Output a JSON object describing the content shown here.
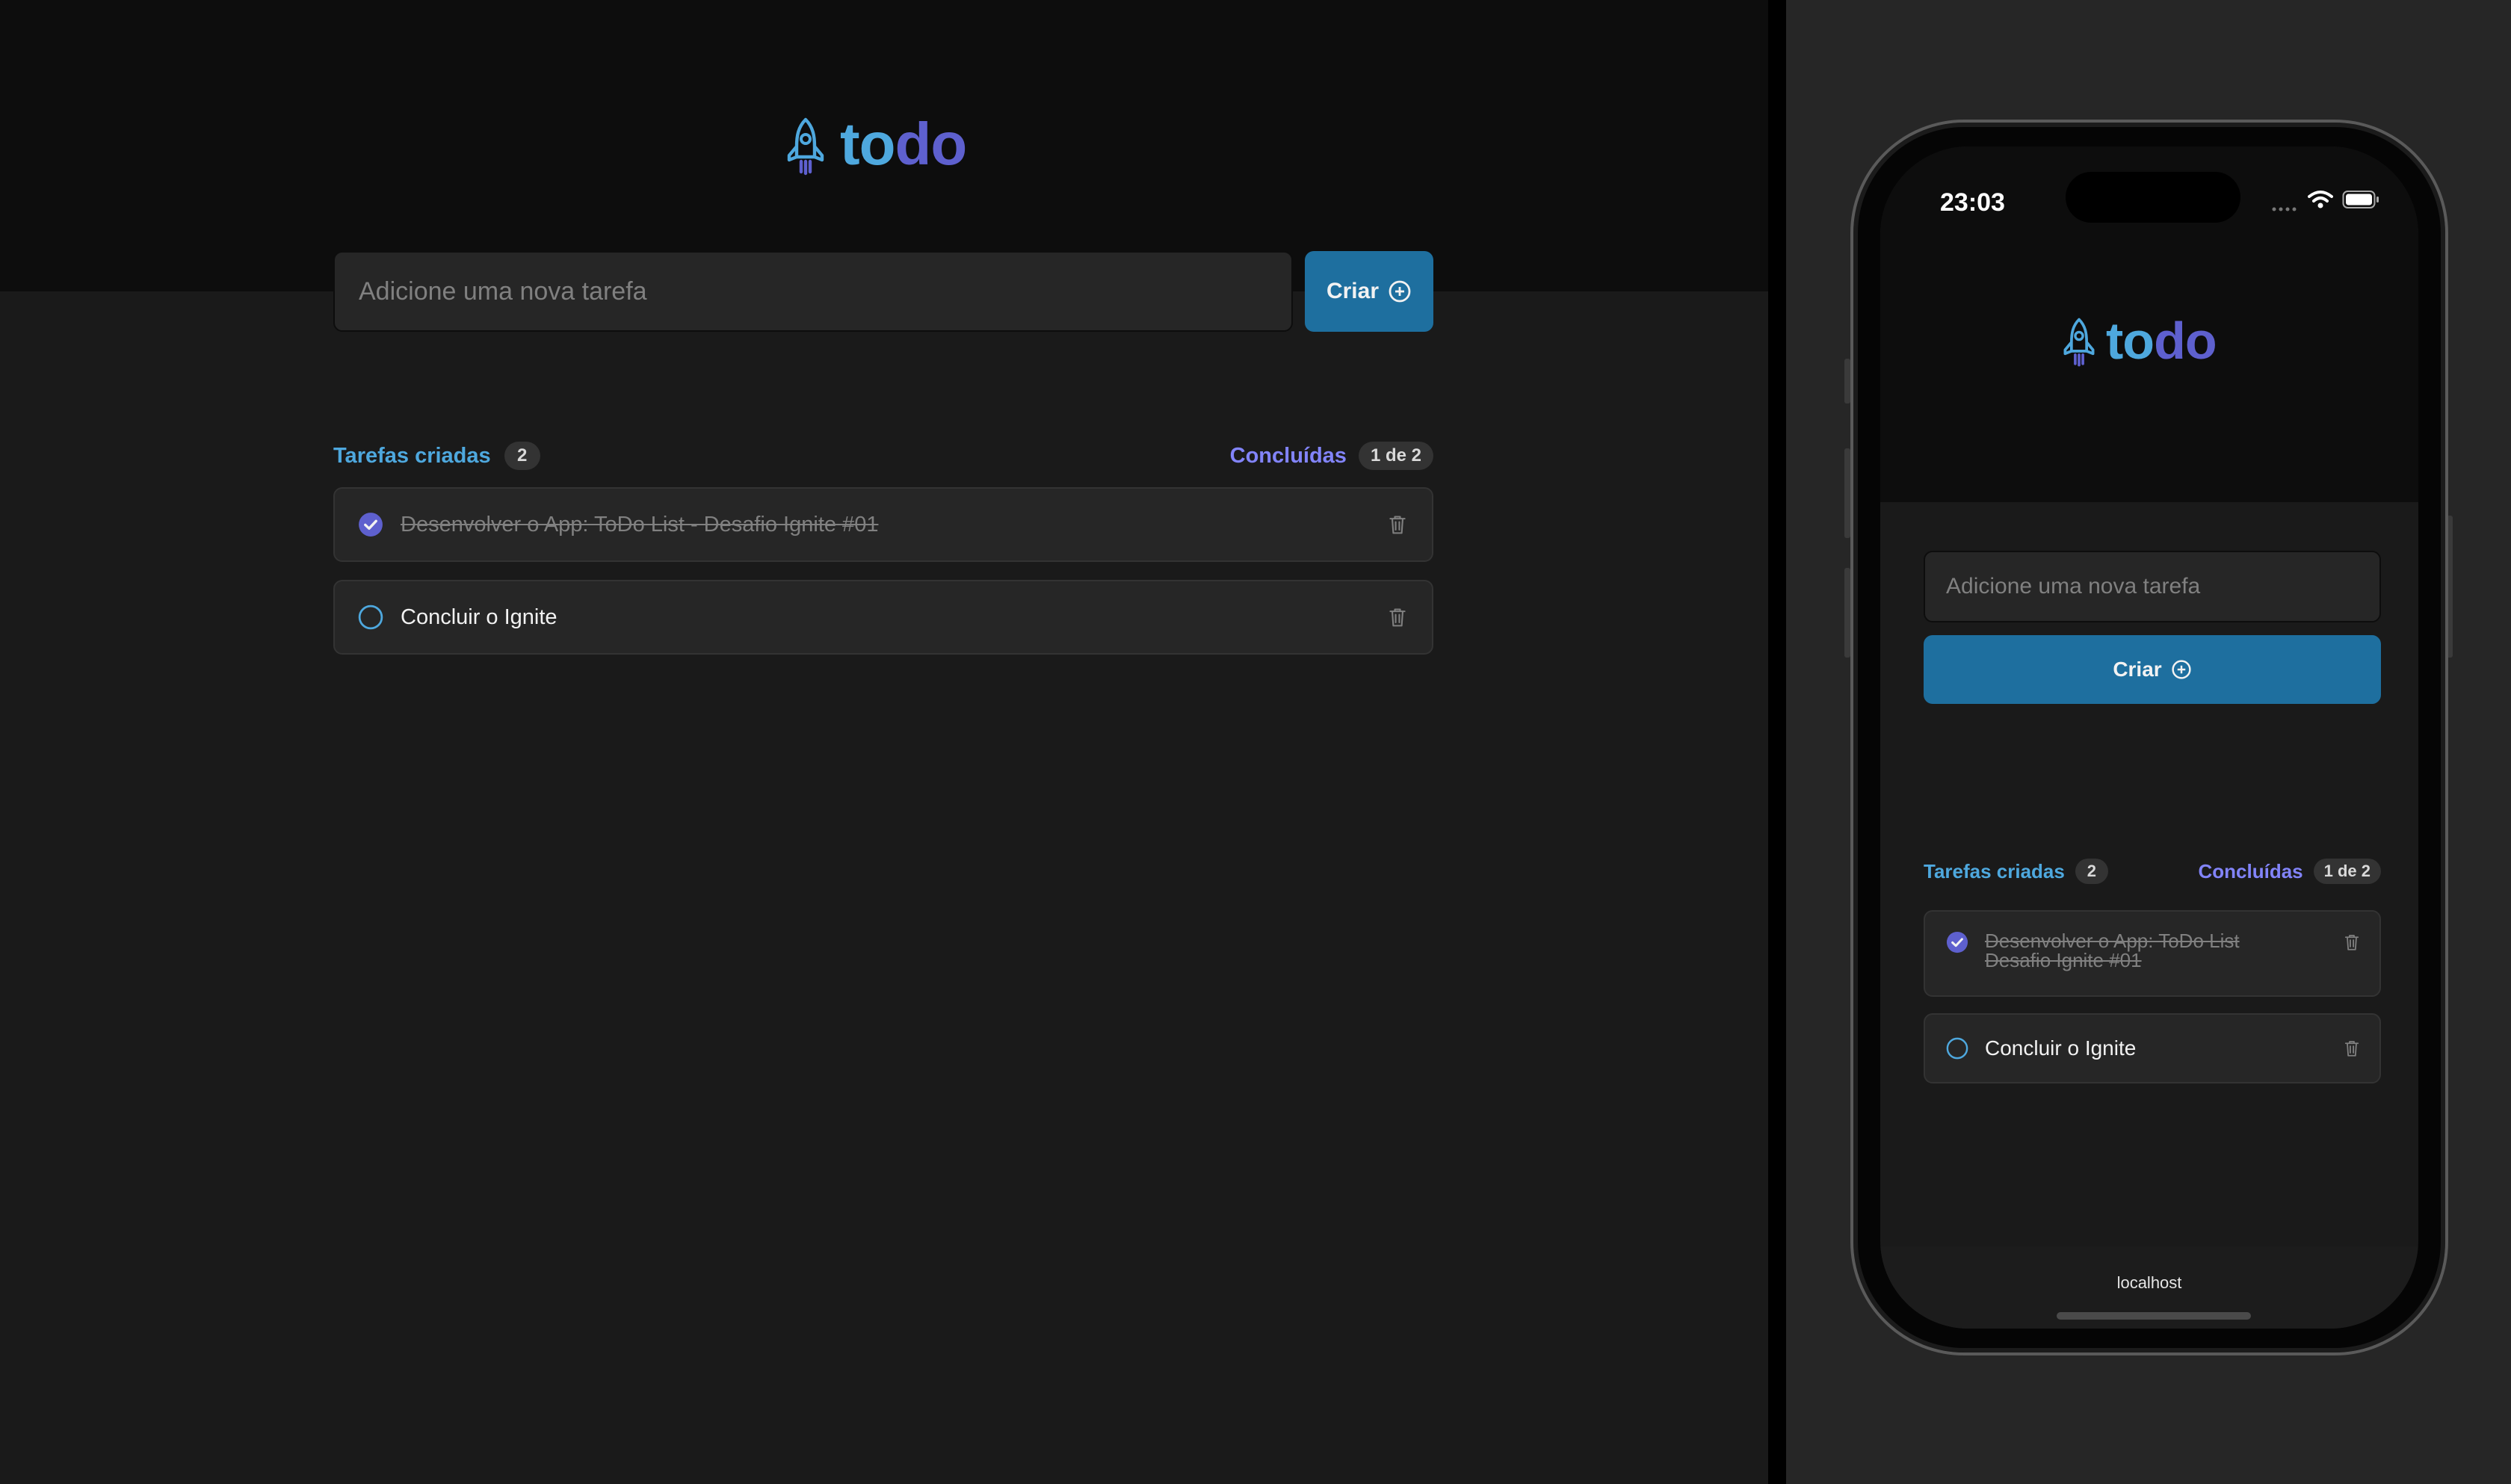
{
  "logo": {
    "part1": "to",
    "part2": "do"
  },
  "new_task": {
    "placeholder": "Adicione uma nova tarefa",
    "button_label": "Criar"
  },
  "counters": {
    "created_label": "Tarefas criadas",
    "created_count": "2",
    "done_label": "Concluídas",
    "done_count": "1 de 2"
  },
  "tasks": [
    {
      "text": "Desenvolver o App: ToDo List - Desafio Ignite #01",
      "done": true
    },
    {
      "text": "Concluir o Ignite",
      "done": false
    }
  ],
  "mobile": {
    "status_time": "23:03",
    "task1_line1": "Desenvolver o App: ToDo List",
    "task1_line2": "Desafio Ignite #01",
    "url": "localhost"
  },
  "colors": {
    "blue": "#4ea8de",
    "purple": "#5e60ce",
    "purple_light": "#8284fa",
    "button": "#1e6f9f",
    "background": "#1a1a1a",
    "header": "#0d0d0d"
  },
  "icons": [
    "rocket-icon",
    "plus-circle-icon",
    "check-circle-icon",
    "circle-icon",
    "trash-icon",
    "wifi-icon",
    "battery-icon",
    "signal-icon"
  ]
}
